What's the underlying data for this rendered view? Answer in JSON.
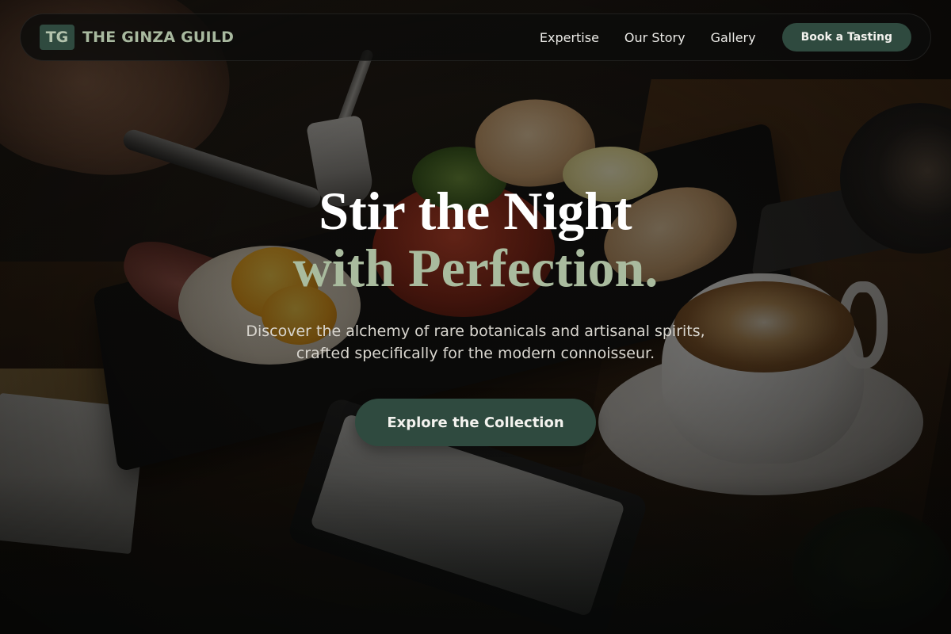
{
  "brand": {
    "logo_mark": "TG",
    "name": "THE GINZA GUILD"
  },
  "nav": {
    "links": [
      {
        "label": "Expertise"
      },
      {
        "label": "Our Story"
      },
      {
        "label": "Gallery"
      }
    ],
    "cta_label": "Book a Tasting"
  },
  "hero": {
    "headline_line1": "Stir the Night",
    "headline_line2": "with Perfection.",
    "subtitle": "Discover the alchemy of rare botanicals and artisanal spirits, crafted specifically for the modern connoisseur.",
    "cta_label": "Explore the Collection",
    "background_image": "breakfast-table-photo"
  },
  "colors": {
    "accent": "#2f4a3f",
    "accent_text": "#a9bb9e",
    "navbar_bg": "#0c0c0b",
    "headline_primary": "#ffffff",
    "body_text": "#d9d6cf"
  }
}
